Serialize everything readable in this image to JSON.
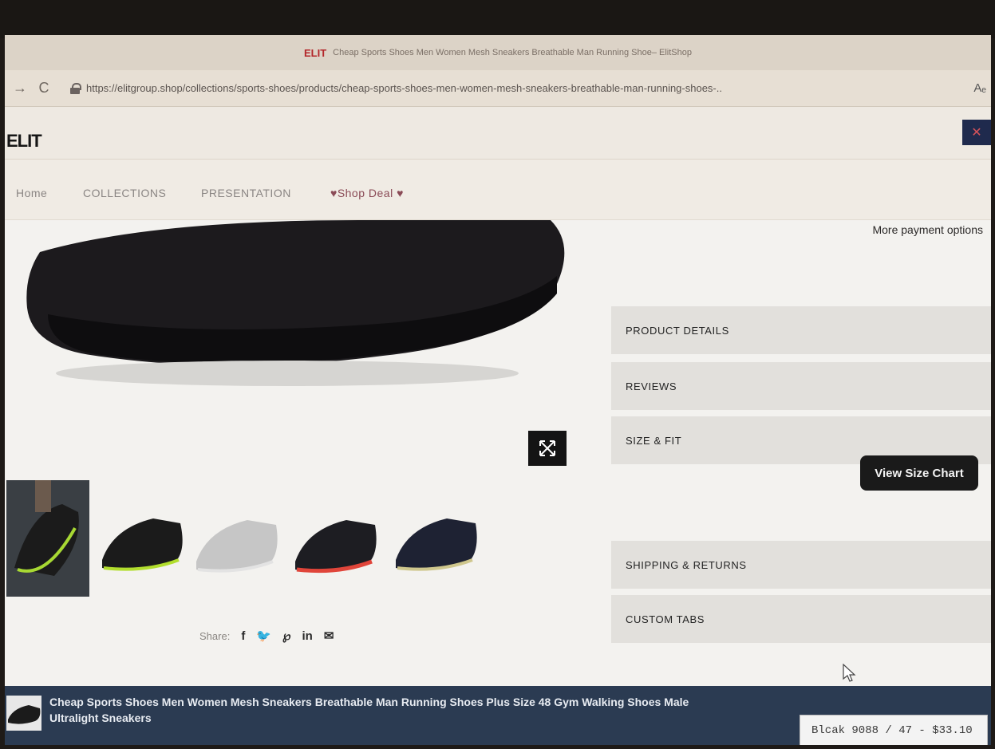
{
  "browser": {
    "tab_logo": "ELIT",
    "tab_title": "Cheap Sports Shoes Men Women Mesh Sneakers Breathable Man Running Shoe– ElitShop",
    "url": "https://elitgroup.shop/collections/sports-shoes/products/cheap-sports-shoes-men-women-mesh-sneakers-breathable-man-running-shoes-..",
    "back_glyph": "→",
    "refresh_glyph": "C",
    "read_aloud_glyph": "Aₑ"
  },
  "site": {
    "logo": "ELIT",
    "menu": [
      "Home",
      "COLLECTIONS",
      "PRESENTATION",
      "♥Shop Deal ♥"
    ]
  },
  "product": {
    "more_payment": "More payment options",
    "accordion": [
      "PRODUCT DETAILS",
      "REVIEWS",
      "SIZE & FIT",
      "SHIPPING & RETURNS",
      "CUSTOM TABS"
    ],
    "size_chart_label": "View Size Chart",
    "share_label": "Share:",
    "thumbnails": [
      {
        "color": "#1b1b1b",
        "accent": "#a7d833"
      },
      {
        "color": "#1b1b1b",
        "accent": "#b2de2e"
      },
      {
        "color": "#c9c9c9",
        "accent": "#e6e6e6"
      },
      {
        "color": "#1d1d22",
        "accent": "#e0453a"
      },
      {
        "color": "#1e2233",
        "accent": "#cfc78d"
      }
    ]
  },
  "sticky": {
    "title": "Cheap Sports Shoes Men Women Mesh Sneakers Breathable Man Running Shoes Plus Size 48 Gym Walking Shoes Male Ultralight Sneakers",
    "variant": "Blcak 9088 / 47 - $33.10"
  },
  "colors": {
    "accent_dark": "#1a1a1a",
    "sticky_bg": "#2b3b52",
    "accordion_bg": "#e2e0dc"
  }
}
